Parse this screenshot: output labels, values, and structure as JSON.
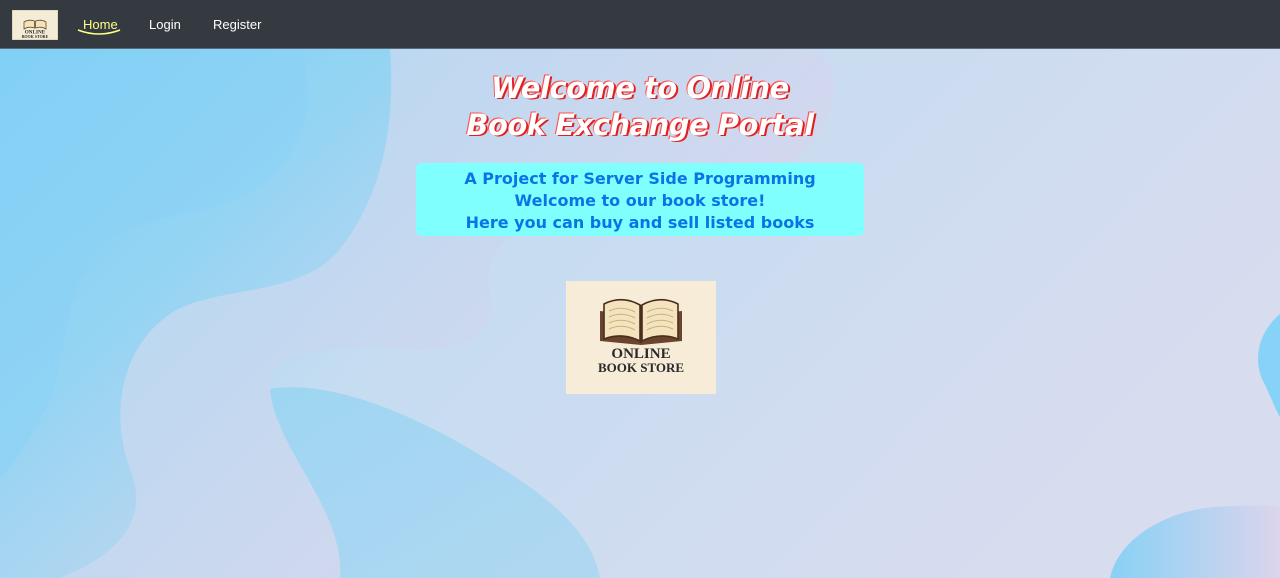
{
  "navbar": {
    "brand_logo": {
      "line1": "ONLINE",
      "line2": "BOOK STORE"
    },
    "links": [
      {
        "label": "Home",
        "active": true
      },
      {
        "label": "Login",
        "active": false
      },
      {
        "label": "Register",
        "active": false
      }
    ]
  },
  "hero": {
    "title_line1": "Welcome to Online",
    "title_line2": "Book Exchange Portal",
    "info": {
      "line1": "A Project for Server Side Programming",
      "line2": "Welcome to our book store!",
      "line3": "Here you can buy and sell listed books"
    },
    "logo": {
      "line1": "ONLINE",
      "line2": "BOOK STORE"
    }
  },
  "colors": {
    "navbar_bg": "#343a40",
    "active_link": "#ffff88",
    "info_box_bg": "#80ffff",
    "info_text": "#0a74e6",
    "title_shadow": "#e02020"
  }
}
